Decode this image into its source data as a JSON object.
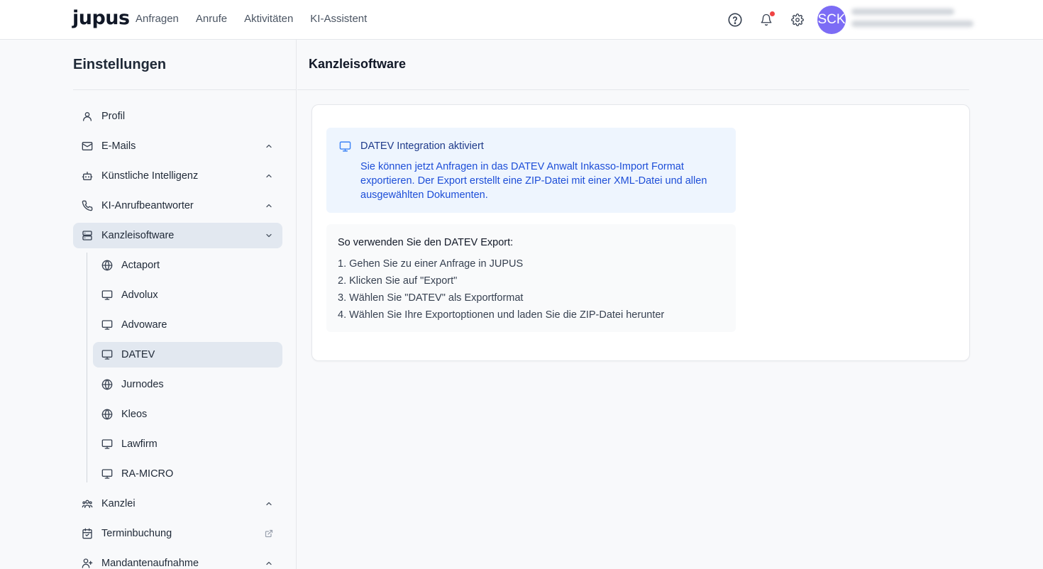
{
  "brand": "jupus",
  "nav": [
    "Anfragen",
    "Anrufe",
    "Aktivitäten",
    "KI-Assistent"
  ],
  "user": {
    "initials": "SCK"
  },
  "sidebar": {
    "title": "Einstellungen",
    "items": [
      {
        "label": "Profil",
        "icon": "user-icon"
      },
      {
        "label": "E-Mails",
        "icon": "mail-icon"
      },
      {
        "label": "Künstliche Intelligenz",
        "icon": "bot-icon"
      },
      {
        "label": "KI-Anrufbeantworter",
        "icon": "phone-icon"
      },
      {
        "label": "Kanzleisoftware",
        "icon": "server-icon"
      }
    ],
    "sub": [
      {
        "label": "Actaport",
        "icon": "globe-icon"
      },
      {
        "label": "Advolux",
        "icon": "monitor-icon"
      },
      {
        "label": "Advoware",
        "icon": "monitor-icon"
      },
      {
        "label": "DATEV",
        "icon": "monitor-icon"
      },
      {
        "label": "Jurnodes",
        "icon": "globe-icon"
      },
      {
        "label": "Kleos",
        "icon": "globe-icon"
      },
      {
        "label": "Lawfirm",
        "icon": "monitor-icon"
      },
      {
        "label": "RA-MICRO",
        "icon": "monitor-icon"
      }
    ],
    "after": [
      {
        "label": "Kanzlei",
        "icon": "users-icon"
      },
      {
        "label": "Terminbuchung",
        "icon": "calendar-icon"
      },
      {
        "label": "Mandantenaufnahme",
        "icon": "user-plus-icon"
      }
    ]
  },
  "main": {
    "title": "Kanzleisoftware",
    "info_title": "DATEV Integration aktiviert",
    "info_text": "Sie können jetzt Anfragen in das DATEV Anwalt Inkasso-Import Format exportieren. Der Export erstellt eine ZIP-Datei mit einer XML-Datei und allen ausgewählten Dokumenten.",
    "how_title": "So verwenden Sie den DATEV Export:",
    "steps": [
      "1. Gehen Sie zu einer Anfrage in JUPUS",
      "2. Klicken Sie auf \"Export\"",
      "3. Wählen Sie \"DATEV\" als Exportformat",
      "4. Wählen Sie Ihre Exportoptionen und laden Sie die ZIP-Datei herunter"
    ]
  }
}
